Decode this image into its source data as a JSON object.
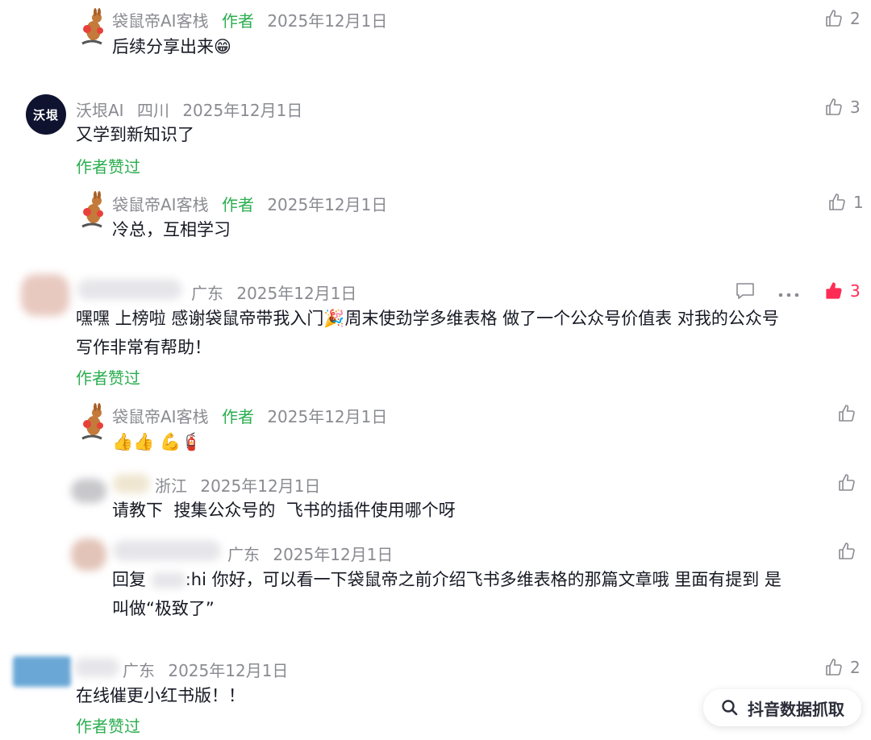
{
  "comments": {
    "c1": {
      "user": "袋鼠帝AI客栈",
      "author_tag": "作者",
      "date": "2025年12月1日",
      "text": "后续分享出来😁",
      "likes": "2"
    },
    "c2": {
      "user": "沃垠AI",
      "avatar_text": "沃垠",
      "location": "四川",
      "date": "2025年12月1日",
      "text": "又学到新知识了",
      "author_liked": "作者赞过",
      "likes": "3"
    },
    "c3": {
      "user": "袋鼠帝AI客栈",
      "author_tag": "作者",
      "date": "2025年12月1日",
      "text": "冷总，互相学习",
      "likes": "1"
    },
    "c4": {
      "location": "广东",
      "date": "2025年12月1日",
      "text_line1": "嘿嘿 上榜啦 感谢袋鼠帝带我入门🎉周末使劲学多维表格 做了一个公众号价值表 对我的公众号",
      "text_line2": "写作非常有帮助！",
      "author_liked": "作者赞过",
      "likes": "3"
    },
    "c5": {
      "user": "袋鼠帝AI客栈",
      "author_tag": "作者",
      "date": "2025年12月1日",
      "text": "👍👍 💪🧯"
    },
    "c6": {
      "location": "浙江",
      "date": "2025年12月1日",
      "text": "请教下  搜集公众号的  飞书的插件使用哪个呀"
    },
    "c7": {
      "location": "广东",
      "date": "2025年12月1日",
      "reply_prefix": "回复",
      "reply_text": ":hi 你好，可以看一下袋鼠帝之前介绍飞书多维表格的那篇文章哦 里面有提到 是",
      "text_line2": "叫做“极致了”"
    },
    "c8": {
      "location": "广东",
      "date": "2025年12月1日",
      "text": "在线催更小红书版！！",
      "author_liked": "作者赞过",
      "likes": "2"
    }
  },
  "floating_button": {
    "label": "抖音数据抓取",
    "icon": "search-icon"
  },
  "colors": {
    "author_green": "#2aae4f",
    "like_red": "#fe2c55",
    "meta_gray": "#8a8b91"
  }
}
